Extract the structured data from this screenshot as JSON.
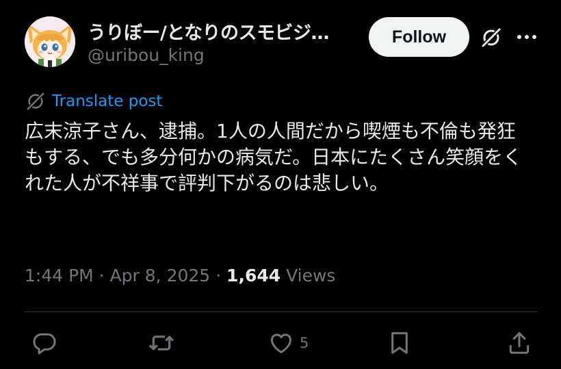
{
  "author": {
    "name": "うりぼー/となりのスモビジ…",
    "handle": "@uribou_king"
  },
  "header": {
    "follow_label": "Follow"
  },
  "translate": {
    "label": "Translate post"
  },
  "post": {
    "text": "広末涼子さん、逮捕。1人の人間だから喫煙も不倫も発狂もする、でも多分何かの病気だ。日本にたくさん笑顔をくれた人が不祥事で評判下がるのは悲しい。"
  },
  "meta": {
    "time": "1:44 PM",
    "separator1": " · ",
    "date": "Apr 8, 2025",
    "separator2": " · ",
    "views_count": "1,644",
    "views_label": " Views"
  },
  "actions": {
    "reply_icon": "reply-icon",
    "repost_icon": "repost-icon",
    "like_icon": "heart-icon",
    "like_count": "5",
    "bookmark_icon": "bookmark-icon",
    "share_icon": "share-icon"
  },
  "colors": {
    "background": "#000000",
    "text_primary": "#e7e9ea",
    "text_secondary": "#71767b",
    "accent": "#1d9bf0",
    "follow_bg": "#eff3f4",
    "divider": "#2f3336"
  }
}
